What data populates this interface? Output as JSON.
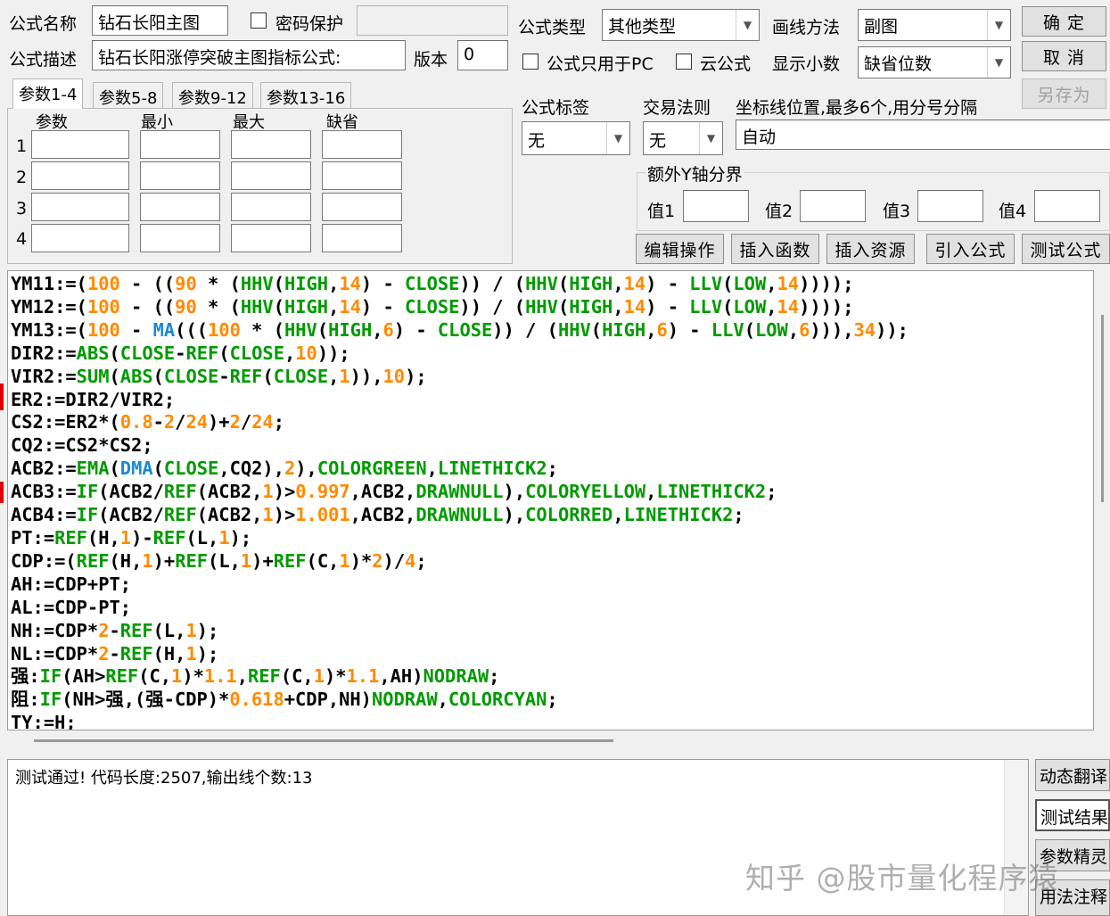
{
  "header": {
    "formula_name_label": "公式名称",
    "formula_name_value": "钻石长阳主图",
    "password_label": "密码保护",
    "formula_desc_label": "公式描述",
    "formula_desc_value": "钻石长阳涨停突破主图指标公式:",
    "version_label": "版本",
    "version_value": "0",
    "formula_type_label": "公式类型",
    "formula_type_value": "其他类型",
    "draw_method_label": "画线方法",
    "draw_method_value": "副图",
    "pc_only_label": "公式只用于PC",
    "cloud_label": "云公式",
    "decimals_label": "显示小数",
    "decimals_value": "缺省位数"
  },
  "buttons": {
    "ok": "确 定",
    "cancel": "取 消",
    "save_as": "另存为",
    "edit_ops": "编辑操作",
    "insert_func": "插入函数",
    "insert_res": "插入资源",
    "import_formula": "引入公式",
    "test_formula": "测试公式"
  },
  "tabs": [
    "参数1-4",
    "参数5-8",
    "参数9-12",
    "参数13-16"
  ],
  "param_table": {
    "headers": [
      "参数",
      "最小",
      "最大",
      "缺省"
    ],
    "rows": [
      "1",
      "2",
      "3",
      "4"
    ]
  },
  "tags": {
    "tag_label": "公式标签",
    "tag_value": "无",
    "trade_rule_label": "交易法则",
    "trade_rule_value": "无",
    "axis_label": "坐标线位置,最多6个,用分号分隔",
    "axis_value": "自动",
    "y_bound_label": "额外Y轴分界",
    "v1": "值1",
    "v2": "值2",
    "v3": "值3",
    "v4": "值4"
  },
  "code_lines": [
    "YM11:=(100 - ((90 * (HHV(HIGH,14) - CLOSE)) / (HHV(HIGH,14) - LLV(LOW,14))));",
    "YM12:=(100 - ((90 * (HHV(HIGH,14) - CLOSE)) / (HHV(HIGH,14) - LLV(LOW,14))));",
    "YM13:=(100 - MA(((100 * (HHV(HIGH,6) - CLOSE)) / (HHV(HIGH,6) - LLV(LOW,6))),34));",
    "DIR2:=ABS(CLOSE-REF(CLOSE,10));",
    "VIR2:=SUM(ABS(CLOSE-REF(CLOSE,1)),10);",
    "ER2:=DIR2/VIR2;",
    "CS2:=ER2*(0.8-2/24)+2/24;",
    "CQ2:=CS2*CS2;",
    "ACB2:=EMA(DMA(CLOSE,CQ2),2),COLORGREEN,LINETHICK2;",
    "ACB3:=IF(ACB2/REF(ACB2,1)>0.997,ACB2,DRAWNULL),COLORYELLOW,LINETHICK2;",
    "ACB4:=IF(ACB2/REF(ACB2,1)>1.001,ACB2,DRAWNULL),COLORRED,LINETHICK2;",
    "PT:=REF(H,1)-REF(L,1);",
    "CDP:=(REF(H,1)+REF(L,1)+REF(C,1)*2)/4;",
    "AH:=CDP+PT;",
    "AL:=CDP-PT;",
    "NH:=CDP*2-REF(L,1);",
    "NL:=CDP*2-REF(H,1);",
    "强:IF(AH>REF(C,1)*1.1,REF(C,1)*1.1,AH)NODRAW;",
    "阻:IF(NH>强,(强-CDP)*0.618+CDP,NH)NODRAW,COLORCYAN;",
    "TY:=H;"
  ],
  "output": {
    "message": "测试通过! 代码长度:2507,输出线个数:13"
  },
  "side_buttons": [
    "动态翻译",
    "测试结果",
    "参数精灵",
    "用法注释"
  ],
  "watermark": "知乎 @股市量化程序猿",
  "colors": {
    "number": "#ff8a00",
    "function": "#009a00",
    "ma_function": "#1a8ad4"
  }
}
